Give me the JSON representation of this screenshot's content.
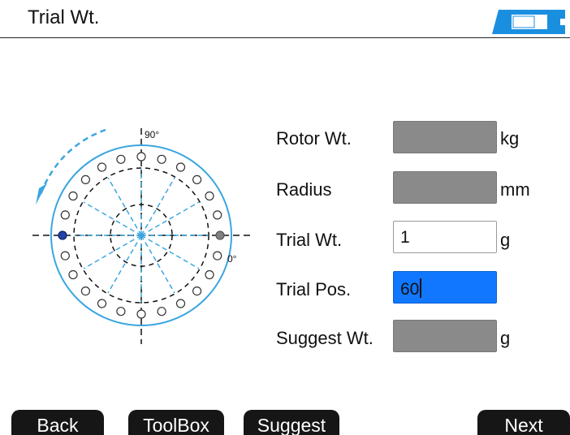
{
  "header": {
    "title": "Trial Wt."
  },
  "diagram": {
    "label_90": "90°",
    "label_0": "0°"
  },
  "form": {
    "rotor_wt": {
      "label": "Rotor Wt.",
      "value": "",
      "unit": "kg"
    },
    "radius": {
      "label": "Radius",
      "value": "",
      "unit": "mm"
    },
    "trial_wt": {
      "label": "Trial Wt.",
      "value": "1",
      "unit": "g"
    },
    "trial_pos": {
      "label": "Trial Pos.",
      "value": "60"
    },
    "suggest_wt": {
      "label": "Suggest Wt.",
      "value": "",
      "unit": "g"
    }
  },
  "toolbar": {
    "back_label": "Back",
    "toolbox_label": "ToolBox",
    "suggest_label": "Suggest",
    "next_label": "Next"
  },
  "colors": {
    "accent_blue": "#1177ff",
    "diagram_blue": "#3aa6e0",
    "readonly_gray": "#8a8a8a"
  },
  "icons": [
    "battery-icon",
    "rotation-arrow-icon"
  ]
}
